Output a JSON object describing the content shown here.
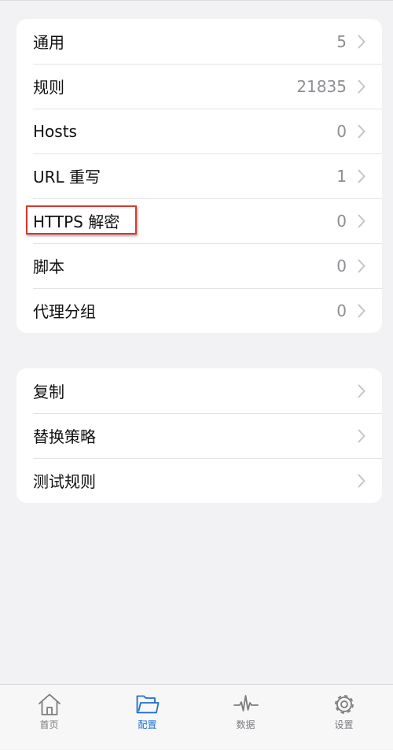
{
  "groups": [
    {
      "items": [
        {
          "label": "通用",
          "value": "5"
        },
        {
          "label": "规则",
          "value": "21835"
        },
        {
          "label": "Hosts",
          "value": "0"
        },
        {
          "label": "URL 重写",
          "value": "1"
        },
        {
          "label": "HTTPS 解密",
          "value": "0"
        },
        {
          "label": "脚本",
          "value": "0"
        },
        {
          "label": "代理分组",
          "value": "0"
        }
      ]
    },
    {
      "items": [
        {
          "label": "复制"
        },
        {
          "label": "替换策略"
        },
        {
          "label": "测试规则"
        }
      ]
    }
  ],
  "highlight": {
    "target": "HTTPS 解密",
    "color": "#d23a32"
  },
  "tabbar": {
    "active": "配置",
    "accent": "#1e6fd2",
    "tabs": [
      {
        "label": "首页",
        "icon": "home-icon"
      },
      {
        "label": "配置",
        "icon": "folder-icon"
      },
      {
        "label": "数据",
        "icon": "activity-icon"
      },
      {
        "label": "设置",
        "icon": "gear-icon"
      }
    ]
  }
}
